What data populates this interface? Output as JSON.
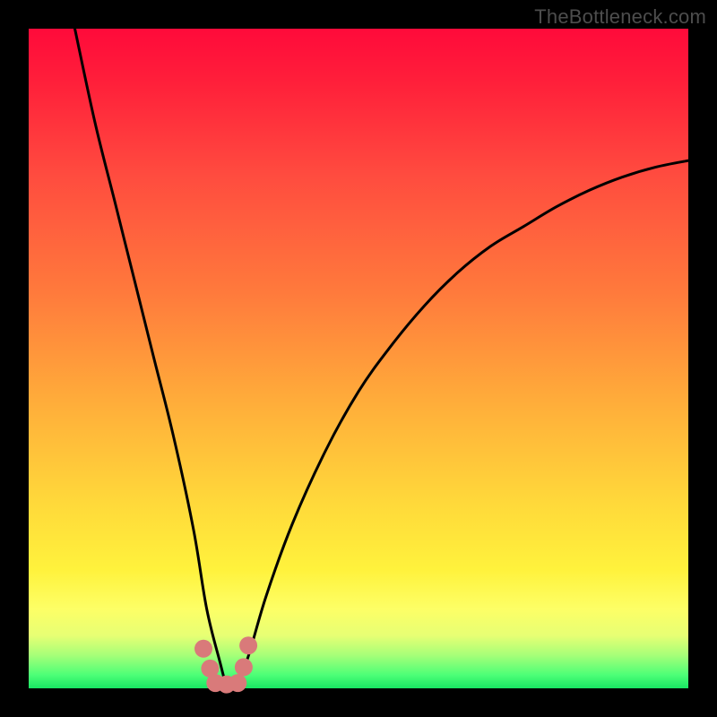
{
  "watermark": "TheBottleneck.com",
  "colors": {
    "frame": "#000000",
    "gradient_top": "#ff0a3a",
    "gradient_bottom": "#18e563",
    "curve": "#000000",
    "markers": "#d97a7a"
  },
  "chart_data": {
    "type": "line",
    "title": "",
    "xlabel": "",
    "ylabel": "",
    "xlim": [
      0,
      100
    ],
    "ylim": [
      0,
      100
    ],
    "series": [
      {
        "name": "bottleneck-curve",
        "x": [
          7,
          10,
          13,
          16,
          19,
          22,
          25,
          27,
          29,
          30,
          31,
          33,
          36,
          40,
          45,
          50,
          55,
          60,
          65,
          70,
          75,
          80,
          85,
          90,
          95,
          100
        ],
        "values": [
          100,
          86,
          74,
          62,
          50,
          38,
          24,
          12,
          4,
          0.5,
          0.5,
          4,
          14,
          25,
          36,
          45,
          52,
          58,
          63,
          67,
          70,
          73,
          75.5,
          77.5,
          79,
          80
        ]
      }
    ],
    "markers": [
      {
        "x": 26.5,
        "y": 6.0
      },
      {
        "x": 27.5,
        "y": 3.0
      },
      {
        "x": 28.3,
        "y": 0.8
      },
      {
        "x": 30.0,
        "y": 0.6
      },
      {
        "x": 31.7,
        "y": 0.8
      },
      {
        "x": 32.6,
        "y": 3.2
      },
      {
        "x": 33.3,
        "y": 6.5
      }
    ],
    "annotations": []
  }
}
